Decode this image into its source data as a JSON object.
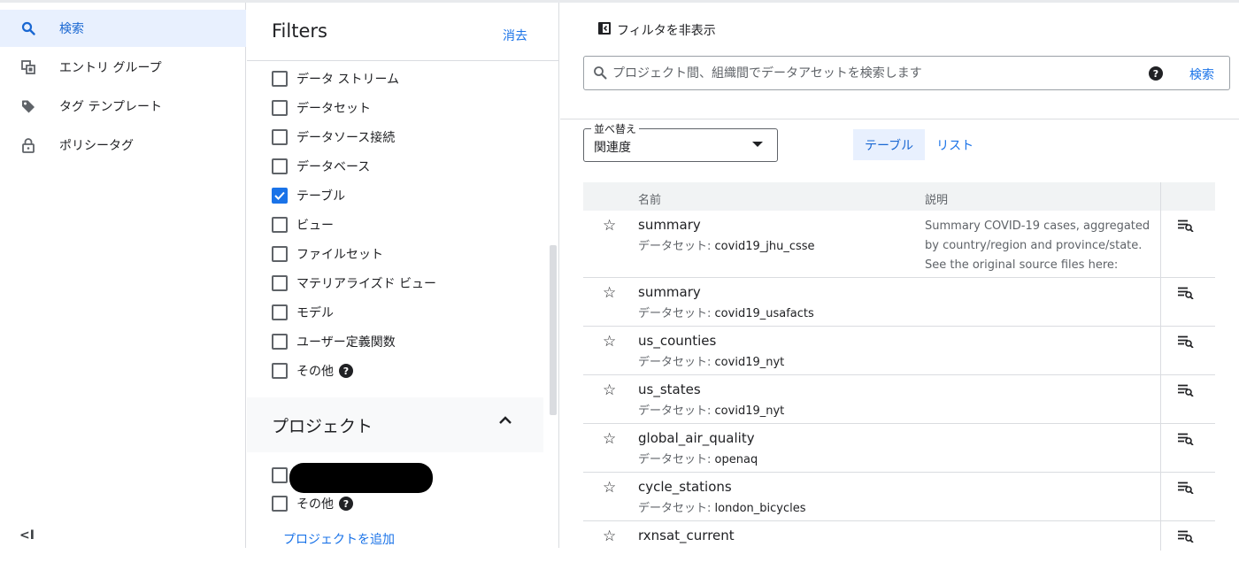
{
  "nav": {
    "items": [
      {
        "label": "検索",
        "icon": "search-icon",
        "active": true
      },
      {
        "label": "エントリ グループ",
        "icon": "entry-group-icon",
        "active": false
      },
      {
        "label": "タグ テンプレート",
        "icon": "tag-icon",
        "active": false
      },
      {
        "label": "ポリシータグ",
        "icon": "lock-icon",
        "active": false
      }
    ],
    "collapse_label": "<I"
  },
  "filters": {
    "title": "Filters",
    "clear_label": "消去",
    "types": [
      {
        "label": "データ ストリーム",
        "checked": false
      },
      {
        "label": "データセット",
        "checked": false
      },
      {
        "label": "データソース接続",
        "checked": false
      },
      {
        "label": "データベース",
        "checked": false
      },
      {
        "label": "テーブル",
        "checked": true
      },
      {
        "label": "ビュー",
        "checked": false
      },
      {
        "label": "ファイルセット",
        "checked": false
      },
      {
        "label": "マテリアライズド ビュー",
        "checked": false
      },
      {
        "label": "モデル",
        "checked": false
      },
      {
        "label": "ユーザー定義関数",
        "checked": false
      },
      {
        "label": "その他",
        "checked": false
      }
    ],
    "project_section_title": "プロジェクト",
    "project_other_label": "その他",
    "add_project_label": "プロジェクトを追加"
  },
  "main": {
    "hide_filters_label": "フィルタを非表示",
    "search": {
      "placeholder": "プロジェクト間、組織間でデータアセットを検索します",
      "button_label": "検索"
    },
    "sort": {
      "label": "並べ替え",
      "value": "関連度"
    },
    "view_toggle": {
      "table_label": "テーブル",
      "list_label": "リスト",
      "active": "table"
    },
    "table": {
      "col_name": "名前",
      "col_desc": "説明",
      "dataset_label": "データセット:",
      "rows": [
        {
          "name": "summary",
          "dataset": "covid19_jhu_csse",
          "description": "Summary COVID-19 cases, aggregated by country/region and province/state. See the original source files here: https://github.com/"
        },
        {
          "name": "summary",
          "dataset": "covid19_usafacts",
          "description": ""
        },
        {
          "name": "us_counties",
          "dataset": "covid19_nyt",
          "description": ""
        },
        {
          "name": "us_states",
          "dataset": "covid19_nyt",
          "description": ""
        },
        {
          "name": "global_air_quality",
          "dataset": "openaq",
          "description": ""
        },
        {
          "name": "cycle_stations",
          "dataset": "london_bicycles",
          "description": ""
        },
        {
          "name": "rxnsat_current",
          "dataset": "",
          "description": ""
        }
      ]
    }
  },
  "colors": {
    "accent": "#1a73e8",
    "active_bg": "#e8f0fe",
    "border": "#dadce0"
  }
}
